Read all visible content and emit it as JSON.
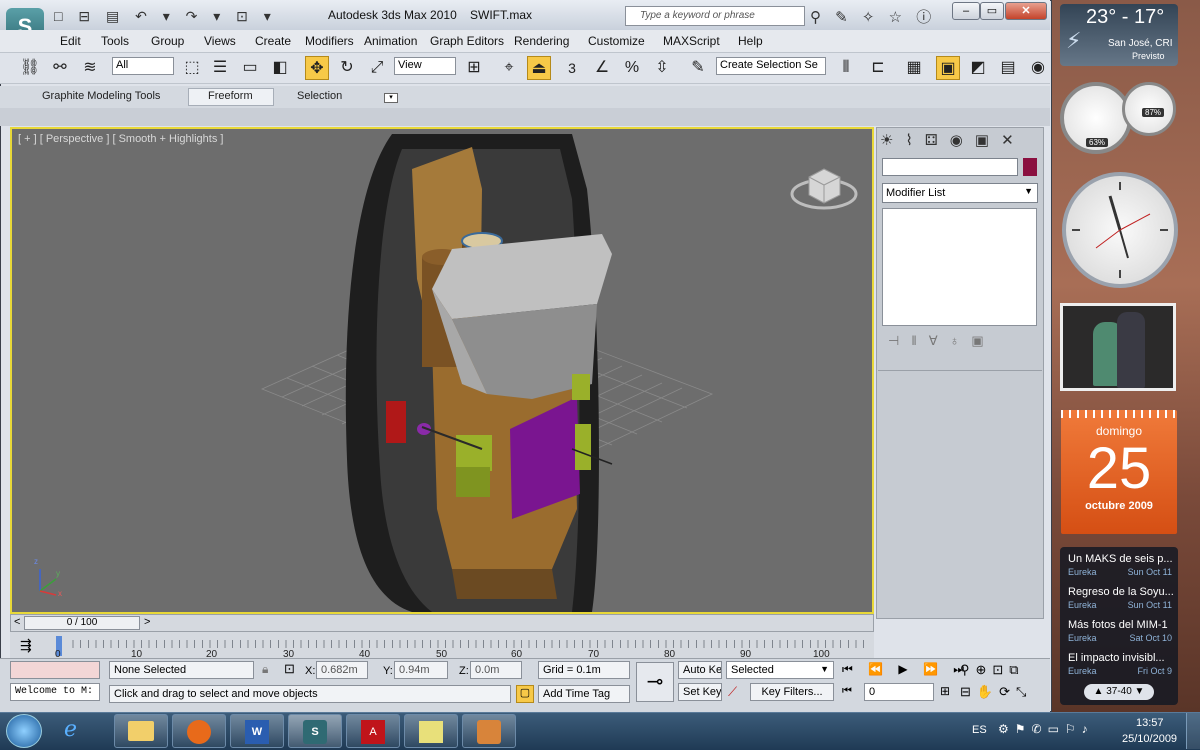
{
  "window": {
    "app_title": "Autodesk 3ds Max  2010",
    "file_title": "SWIFT.max",
    "search_placeholder": "Type a keyword or phrase"
  },
  "menu": [
    "Edit",
    "Tools",
    "Group",
    "Views",
    "Create",
    "Modifiers",
    "Animation",
    "Graph Editors",
    "Rendering",
    "Customize",
    "MAXScript",
    "Help"
  ],
  "toolbar": {
    "selection_filter": "All",
    "reference_coord": "View",
    "named_selection": "Create Selection Se",
    "snap_toggle": "3"
  },
  "ribbon": {
    "tabs": [
      "Graphite Modeling Tools",
      "Freeform",
      "Selection"
    ],
    "active": "Freeform"
  },
  "viewport": {
    "label": "[ + ] [ Perspective ] [ Smooth + Highlights ]",
    "axis_x": "x",
    "axis_y": "y",
    "axis_z": "z"
  },
  "command_panel": {
    "modifier_list": "Modifier List"
  },
  "timeline": {
    "frame_display": "0 / 100",
    "prev": "<",
    "next": ">",
    "ticks": [
      "0",
      "10",
      "20",
      "30",
      "40",
      "50",
      "60",
      "70",
      "80",
      "90",
      "100"
    ]
  },
  "status": {
    "maxscript_listener": "Welcome to M:",
    "selection": "None Selected",
    "prompt": "Click and drag to select and move objects",
    "x_label": "X:",
    "x_value": "0.682m",
    "y_label": "Y:",
    "y_value": "0.94m",
    "z_label": "Z:",
    "z_value": "0.0m",
    "grid": "Grid = 0.1m",
    "add_time_tag": "Add Time Tag",
    "auto_key": "Auto Key",
    "set_key": "Set Key",
    "key_mode": "Selected",
    "key_filters": "Key Filters...",
    "current_frame": "0"
  },
  "gadgets": {
    "weather": {
      "temps": "23° - 17°",
      "city": "San José, CRI",
      "forecast": "Previsto"
    },
    "cpu_meter": {
      "cpu": "63%",
      "memory": "87%"
    },
    "calendar": {
      "weekday": "domingo",
      "day": "25",
      "month_year": "octubre 2009"
    },
    "news": [
      {
        "title": "Un MAKS de seis p...",
        "source": "Eureka",
        "date": "Sun Oct 11"
      },
      {
        "title": "Regreso de la Soyu...",
        "source": "Eureka",
        "date": "Sun Oct 11"
      },
      {
        "title": "Más fotos del MIM-1",
        "source": "Eureka",
        "date": "Sat Oct 10"
      },
      {
        "title": "El impacto invisibl...",
        "source": "Eureka",
        "date": "Fri Oct 9"
      }
    ],
    "news_pager": "37-40"
  },
  "taskbar": {
    "lang": "ES",
    "time": "13:57",
    "date": "25/10/2009"
  },
  "colors": {
    "viewport_border": "#e8d838",
    "calendar_orange": "#e2601f",
    "swatch": "#8b1040"
  }
}
